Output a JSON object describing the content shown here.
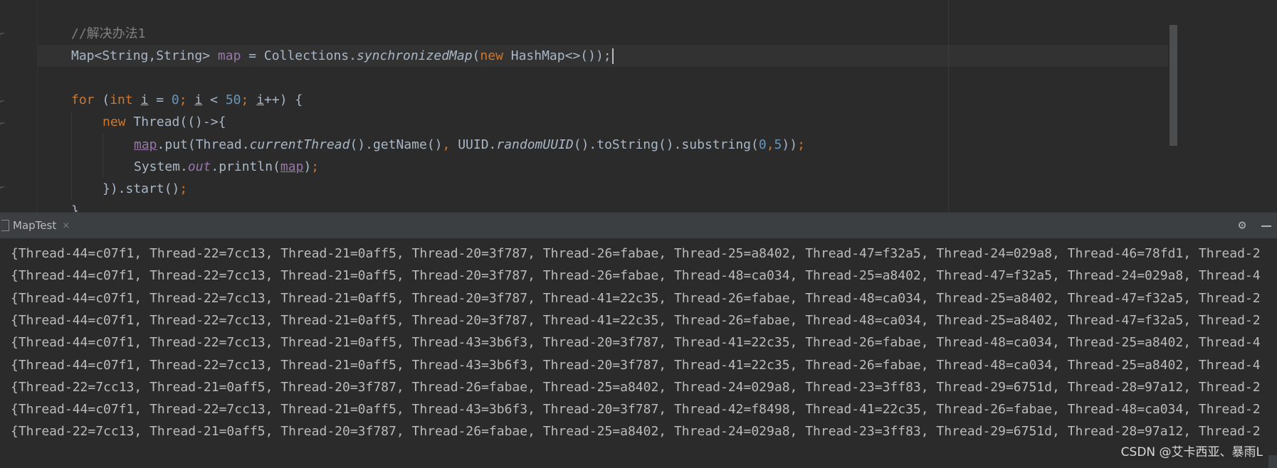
{
  "editor": {
    "lines": [
      {
        "id": "comment",
        "tokens": [
          {
            "t": "//解决办法1",
            "c": "c-cmt"
          }
        ]
      },
      {
        "id": "map-decl",
        "caret": true,
        "tokens": [
          {
            "t": "Map<String,String> "
          },
          {
            "t": "map",
            "c": "c-fld"
          },
          {
            "t": " = Collections."
          },
          {
            "t": "synchronizedMap",
            "c": "c-it"
          },
          {
            "t": "("
          },
          {
            "t": "new ",
            "c": "c-kw"
          },
          {
            "t": "HashMap<>());"
          }
        ]
      },
      {
        "id": "blank",
        "tokens": []
      },
      {
        "id": "for-loop",
        "tokens": [
          {
            "t": "for ",
            "c": "c-kw"
          },
          {
            "t": "("
          },
          {
            "t": "int ",
            "c": "c-kw"
          },
          {
            "t": "i",
            "c": "c-loc"
          },
          {
            "t": " = "
          },
          {
            "t": "0",
            "c": "c-num"
          },
          {
            "t": "; ",
            "c": "c-kw"
          },
          {
            "t": "i",
            "c": "c-loc"
          },
          {
            "t": " < "
          },
          {
            "t": "50",
            "c": "c-num"
          },
          {
            "t": "; ",
            "c": "c-kw"
          },
          {
            "t": "i",
            "c": "c-loc"
          },
          {
            "t": "++) {"
          }
        ]
      },
      {
        "id": "new-thread",
        "tokens": [
          {
            "t": "new ",
            "c": "c-kw"
          },
          {
            "t": "Thread(()->{"
          }
        ]
      },
      {
        "id": "map-put",
        "tokens": [
          {
            "t": "map",
            "c": "c-fldu"
          },
          {
            "t": ".put(Thread."
          },
          {
            "t": "currentThread",
            "c": "c-it"
          },
          {
            "t": "().getName()"
          },
          {
            "t": ", ",
            "c": "c-kw"
          },
          {
            "t": "UUID."
          },
          {
            "t": "randomUUID",
            "c": "c-it"
          },
          {
            "t": "().toString().substring("
          },
          {
            "t": "0",
            "c": "c-num"
          },
          {
            "t": ",",
            "c": "c-kw"
          },
          {
            "t": "5",
            "c": "c-num"
          },
          {
            "t": "))"
          },
          {
            "t": ";",
            "c": "c-kw"
          }
        ]
      },
      {
        "id": "println",
        "tokens": [
          {
            "t": "System."
          },
          {
            "t": "out",
            "c": "c-ital"
          },
          {
            "t": ".println("
          },
          {
            "t": "map",
            "c": "c-fldu"
          },
          {
            "t": ")"
          },
          {
            "t": ";",
            "c": "c-kw"
          }
        ]
      },
      {
        "id": "thread-start",
        "tokens": [
          {
            "t": "}).start()"
          },
          {
            "t": ";",
            "c": "c-kw"
          }
        ]
      },
      {
        "id": "loop-close",
        "tokens": [
          {
            "t": "}"
          }
        ]
      }
    ]
  },
  "run_panel": {
    "tab_label": "MapTest",
    "close_glyph": "×",
    "settings_icon": "gear-icon",
    "minimize_icon": "minimize-icon"
  },
  "console": {
    "lines": [
      "{Thread-44=c07f1, Thread-22=7cc13, Thread-21=0aff5, Thread-20=3f787, Thread-26=fabae, Thread-25=a8402, Thread-47=f32a5, Thread-24=029a8, Thread-46=78fd1, Thread-2",
      "{Thread-44=c07f1, Thread-22=7cc13, Thread-21=0aff5, Thread-20=3f787, Thread-26=fabae, Thread-48=ca034, Thread-25=a8402, Thread-47=f32a5, Thread-24=029a8, Thread-4",
      "{Thread-44=c07f1, Thread-22=7cc13, Thread-21=0aff5, Thread-20=3f787, Thread-41=22c35, Thread-26=fabae, Thread-48=ca034, Thread-25=a8402, Thread-47=f32a5, Thread-2",
      "{Thread-44=c07f1, Thread-22=7cc13, Thread-21=0aff5, Thread-20=3f787, Thread-41=22c35, Thread-26=fabae, Thread-48=ca034, Thread-25=a8402, Thread-47=f32a5, Thread-2",
      "{Thread-44=c07f1, Thread-22=7cc13, Thread-21=0aff5, Thread-43=3b6f3, Thread-20=3f787, Thread-41=22c35, Thread-26=fabae, Thread-48=ca034, Thread-25=a8402, Thread-4",
      "{Thread-44=c07f1, Thread-22=7cc13, Thread-21=0aff5, Thread-43=3b6f3, Thread-20=3f787, Thread-41=22c35, Thread-26=fabae, Thread-48=ca034, Thread-25=a8402, Thread-4",
      "{Thread-22=7cc13, Thread-21=0aff5, Thread-20=3f787, Thread-26=fabae, Thread-25=a8402, Thread-24=029a8, Thread-23=3ff83, Thread-29=6751d, Thread-28=97a12, Thread-2",
      "{Thread-44=c07f1, Thread-22=7cc13, Thread-21=0aff5, Thread-43=3b6f3, Thread-20=3f787, Thread-42=f8498, Thread-41=22c35, Thread-26=fabae, Thread-48=ca034, Thread-2",
      "{Thread-22=7cc13, Thread-21=0aff5, Thread-20=3f787, Thread-26=fabae, Thread-25=a8402, Thread-24=029a8, Thread-23=3ff83, Thread-29=6751d, Thread-28=97a12, Thread-2"
    ]
  },
  "watermark": "CSDN @艾卡西亚、暴雨L",
  "colors": {
    "editor_bg": "#2b2b2b",
    "keyword": "#cc7832",
    "field": "#9876aa",
    "number": "#6897bb",
    "comment": "#808080",
    "text": "#a9b7c6",
    "panel_header": "#3c3f41"
  }
}
